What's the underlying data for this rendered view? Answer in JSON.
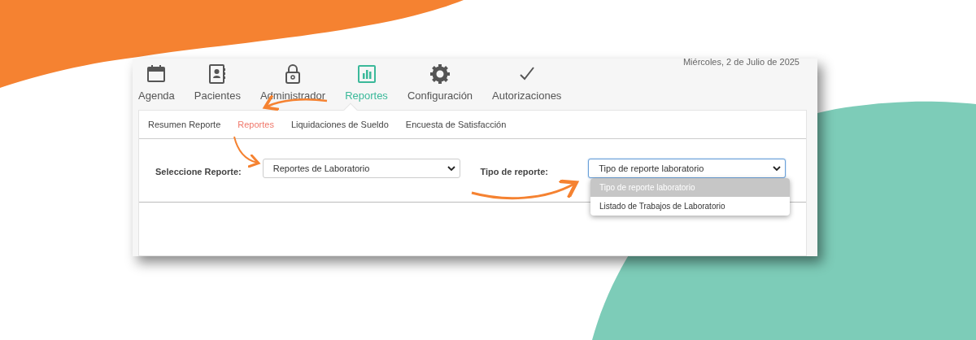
{
  "date": "Miércoles, 2 de Julio de 2025",
  "top_nav": [
    {
      "label": "Agenda",
      "selected": false
    },
    {
      "label": "Pacientes",
      "selected": false
    },
    {
      "label": "Administrador",
      "selected": false
    },
    {
      "label": "Reportes",
      "selected": true
    },
    {
      "label": "Configuración",
      "selected": false
    },
    {
      "label": "Autorizaciones",
      "selected": false
    }
  ],
  "sub_tabs": [
    {
      "label": "Resumen Reporte",
      "selected": false
    },
    {
      "label": "Reportes",
      "selected": true
    },
    {
      "label": "Liquidaciones de Sueldo",
      "selected": false
    },
    {
      "label": "Encuesta de Satisfacción",
      "selected": false
    }
  ],
  "form": [
    {
      "label": "Seleccione Reporte:",
      "value": "Reportes de Laboratorio",
      "focused": false
    },
    {
      "label": "Tipo de reporte:",
      "value": "Tipo de reporte laboratorio",
      "focused": true,
      "options": [
        {
          "label": "Tipo de reporte laboratorio",
          "selected": true
        },
        {
          "label": "Listado de Trabajos de Laboratorio",
          "selected": false
        }
      ]
    }
  ]
}
